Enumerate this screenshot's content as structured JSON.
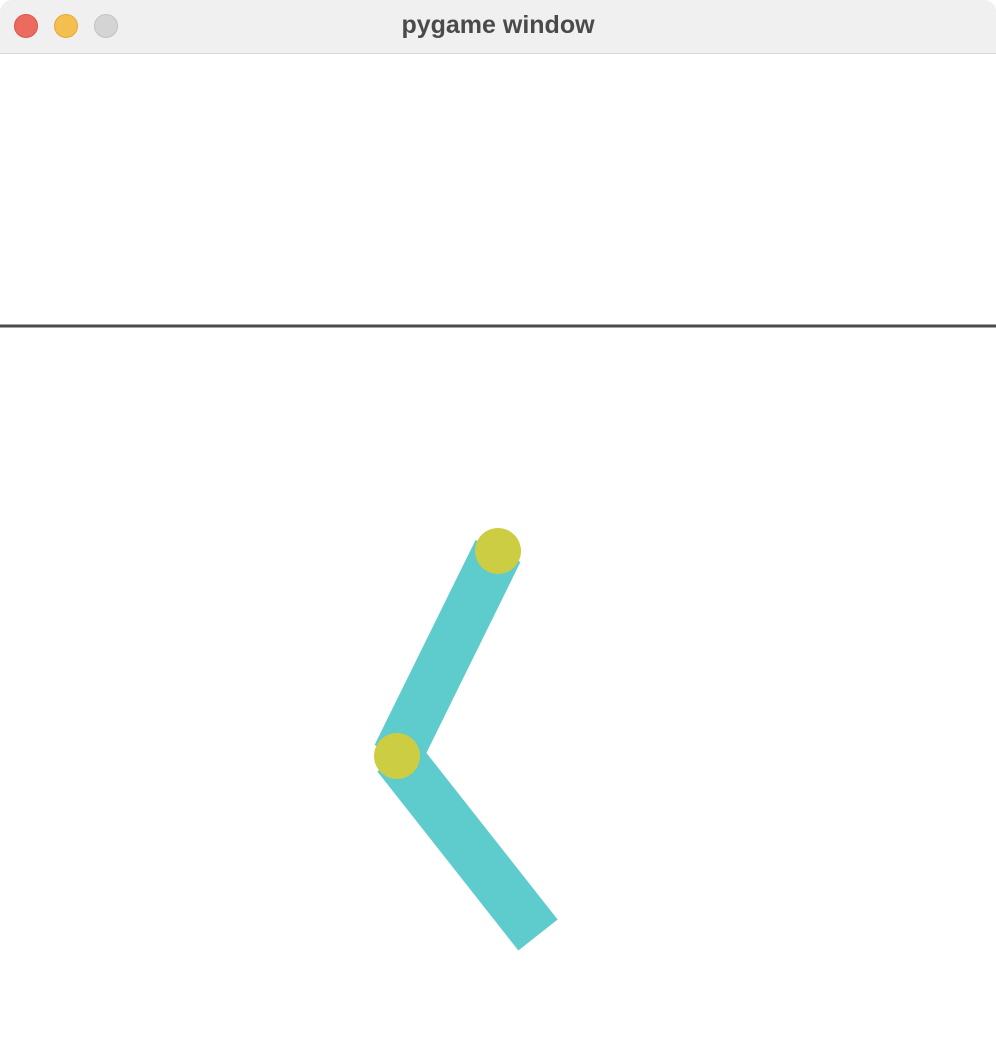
{
  "window": {
    "title": "pygame window",
    "controls": [
      "close",
      "minimize",
      "zoom"
    ]
  },
  "scene": {
    "background_color": "#ffffff",
    "floor_line_color": "#4b4b4b",
    "arm_color": "#5ecbcc",
    "joint_color": "#cccd42",
    "segments": [
      {
        "name": "upper-arm",
        "from": "top-joint",
        "to": "elbow-joint"
      },
      {
        "name": "lower-arm",
        "from": "elbow-joint",
        "to": "arm-end"
      }
    ],
    "joints": [
      "top-joint",
      "elbow-joint"
    ]
  }
}
